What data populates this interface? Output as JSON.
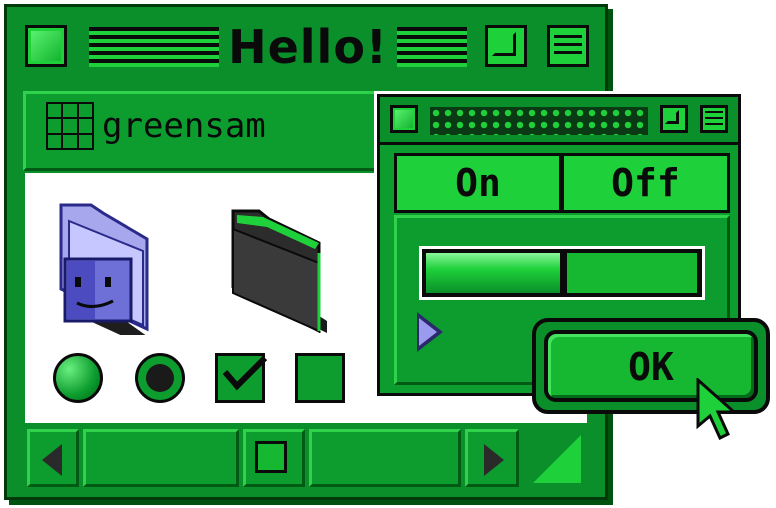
{
  "window": {
    "title": "Hello!",
    "address": "greensam"
  },
  "dialog": {
    "segments": [
      "On",
      "Off"
    ],
    "progress": 0.5,
    "ok_label": "OK"
  },
  "controls": {
    "checkbox_checked": true,
    "checkbox_unchecked": false,
    "radio_selected": false
  },
  "colors": {
    "accent": "#1ed13a",
    "dark": "#0a0a0a",
    "window": "#0a8f2a",
    "icon_finder": "#8f8fe0"
  },
  "icons": [
    "close-icon",
    "zoom-icon",
    "collapse-icon",
    "grid-view-icon",
    "finder-folder-icon",
    "dark-folder-icon",
    "scroll-left-icon",
    "scroll-right-icon",
    "resize-grip-icon",
    "disclosure-triangle-icon",
    "cursor-arrow-icon"
  ]
}
